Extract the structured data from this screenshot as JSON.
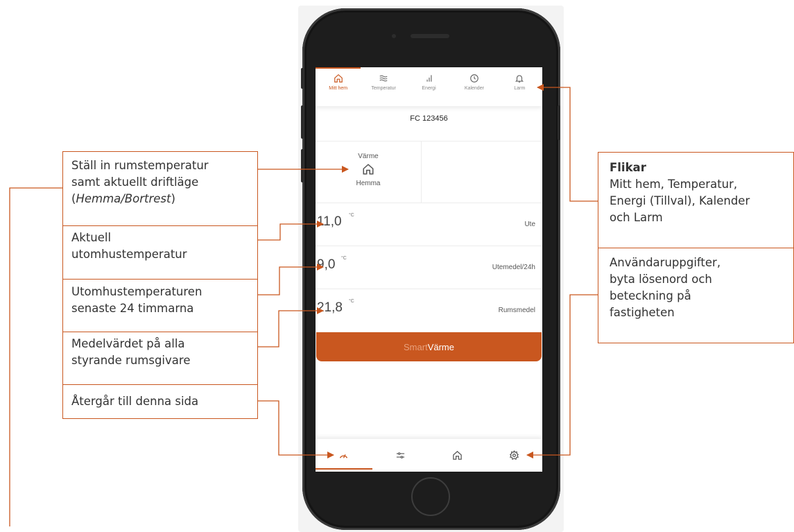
{
  "tabs": [
    {
      "label": "Mitt hem",
      "icon": "home-icon",
      "active": true
    },
    {
      "label": "Temperatur",
      "icon": "waves-icon",
      "active": false
    },
    {
      "label": "Energi",
      "icon": "bar-chart-icon",
      "active": false
    },
    {
      "label": "Kalender",
      "icon": "clock-icon",
      "active": false
    },
    {
      "label": "Larm",
      "icon": "bell-icon",
      "active": false
    }
  ],
  "device_id": "FC 123456",
  "mode_card": {
    "title": "Värme",
    "status": "Hemma",
    "icon": "home-icon"
  },
  "readings": [
    {
      "value": "11,0",
      "unit": "°C",
      "label": "Ute"
    },
    {
      "value": "9,0",
      "unit": "°C",
      "label": "Utemedel/24h"
    },
    {
      "value": "21,8",
      "unit": "°C",
      "label": "Rumsmedel"
    }
  ],
  "smart_button": {
    "part1": "Smart",
    "part2": "Värme"
  },
  "bottom_nav": [
    {
      "icon": "gauge-icon",
      "active": true
    },
    {
      "icon": "sliders-icon",
      "active": false
    },
    {
      "icon": "home-icon",
      "active": false
    },
    {
      "icon": "gear-icon",
      "active": false
    }
  ],
  "callouts_left": {
    "set_temp": {
      "line1": "Ställ in rumstemperatur",
      "line2": "samt aktuellt driftläge",
      "line3_open": "(",
      "line3_italic": "Hemma/Bortrest",
      "line3_close": ")"
    },
    "outdoor_now": {
      "line1": "Aktuell",
      "line2": "utomhustemperatur"
    },
    "outdoor_24h": {
      "line1": "Utomhustemperaturen",
      "line2": "senaste 24 timmarna"
    },
    "room_avg": {
      "line1": "Medelvärdet på alla",
      "line2": "styrande rumsgivare"
    },
    "back": {
      "line1": "Återgår till denna sida"
    }
  },
  "callouts_right": {
    "tabs": {
      "title": "Flikar",
      "line1": "Mitt hem, Temperatur,",
      "line2": "Energi (Tillval), Kalender",
      "line3": "och Larm"
    },
    "settings": {
      "line1": "Användaruppgifter,",
      "line2": "byta lösenord och",
      "line3": "beteckning på",
      "line4": "fastigheten"
    }
  },
  "colors": {
    "accent": "#c9571f",
    "accent_light": "#e8a07c"
  }
}
